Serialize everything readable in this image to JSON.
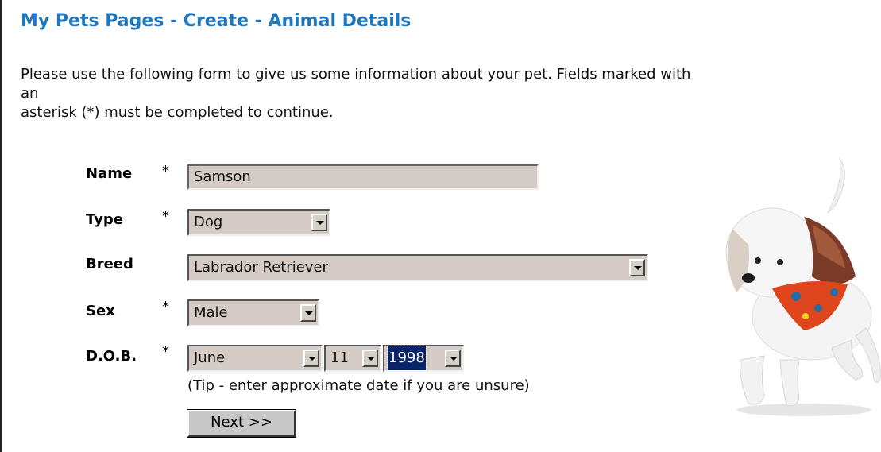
{
  "page": {
    "title": "My Pets Pages - Create - Animal Details",
    "intro_line1": "Please use the following form to give us some information about your pet. Fields marked with",
    "intro_line2": "an",
    "intro_line3": "asterisk (*) must be completed to continue."
  },
  "form": {
    "required_marker": "*",
    "name": {
      "label": "Name",
      "value": "Samson"
    },
    "type": {
      "label": "Type",
      "value": "Dog"
    },
    "breed": {
      "label": "Breed",
      "value": "Labrador Retriever"
    },
    "sex": {
      "label": "Sex",
      "value": "Male"
    },
    "dob": {
      "label": "D.O.B.",
      "month": "June",
      "day": "11",
      "year": "1998"
    },
    "tip": "(Tip - enter approximate date if you are unsure)",
    "next_button": "Next >>"
  },
  "colors": {
    "title": "#1d78c1",
    "field_bg": "#d4ccc4",
    "highlight": "#0a246a"
  },
  "image": {
    "subject": "small white dog wearing orange bandana"
  }
}
